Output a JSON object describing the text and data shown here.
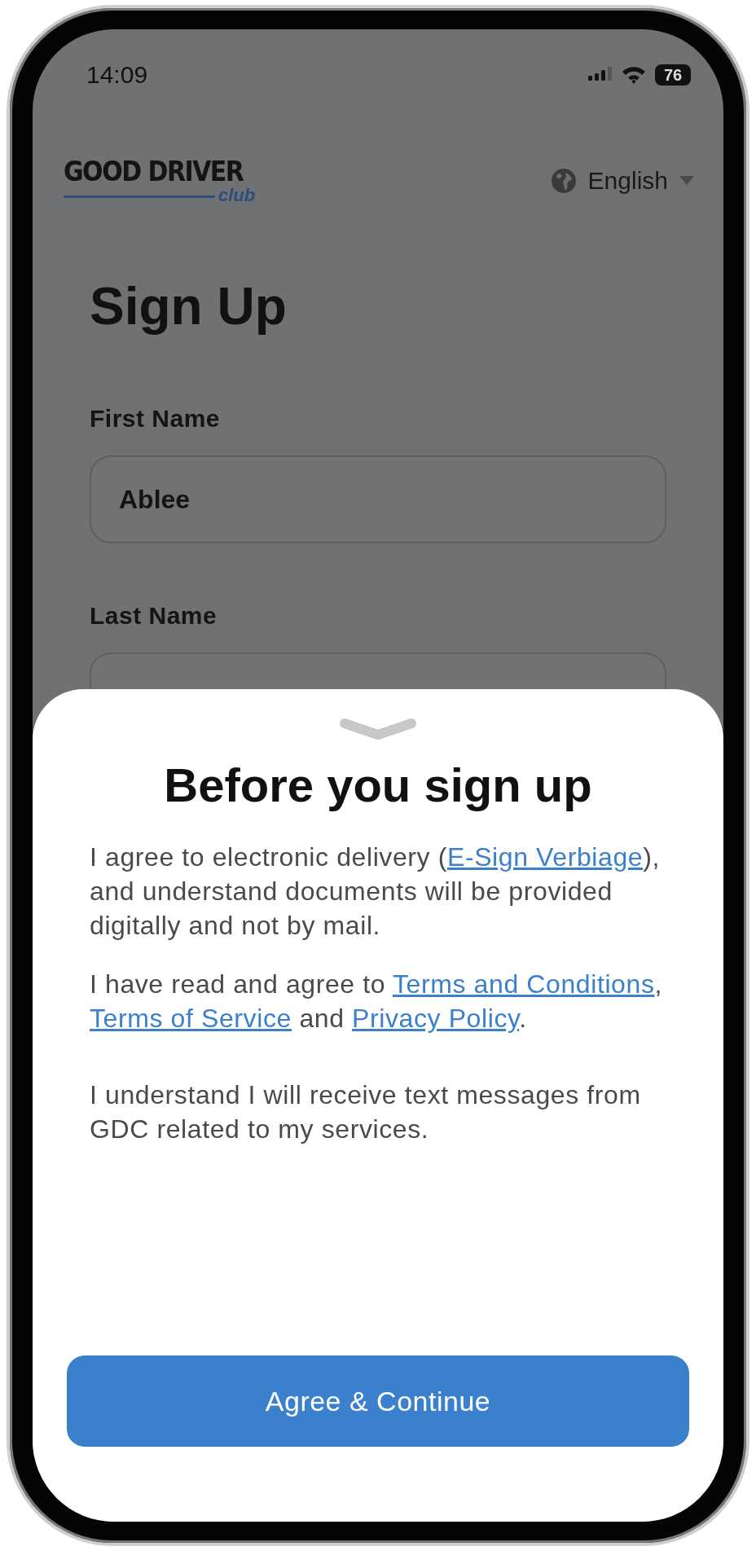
{
  "status_bar": {
    "time": "14:09",
    "battery": "76"
  },
  "header": {
    "logo": {
      "brand": "GOOD DRIVER",
      "tagline": "club"
    },
    "language": "English"
  },
  "form": {
    "title": "Sign Up",
    "fields": [
      {
        "label": "First Name",
        "value": "Ablee"
      },
      {
        "label": "Last Name"
      }
    ]
  },
  "sheet": {
    "title": "Before you sign up",
    "paragraphs": [
      {
        "parts": [
          {
            "text": "I agree to electronic delivery (",
            "link": false
          },
          {
            "text": "E-Sign Verbiage",
            "link": true
          },
          {
            "text": "), and understand documents will be provided digitally and not by mail.",
            "link": false
          }
        ]
      },
      {
        "parts": [
          {
            "text": "I have read and agree to ",
            "link": false
          },
          {
            "text": "Terms and Conditions",
            "link": true
          },
          {
            "text": ", ",
            "link": false
          },
          {
            "text": "Terms of Service",
            "link": true
          },
          {
            "text": " and ",
            "link": false
          },
          {
            "text": "Privacy Policy",
            "link": true
          },
          {
            "text": ".",
            "link": false
          }
        ]
      },
      {
        "parts": [
          {
            "text": "I understand I will receive text messages from GDC related to my services.",
            "link": false
          }
        ]
      }
    ],
    "button": "Agree & Continue"
  }
}
